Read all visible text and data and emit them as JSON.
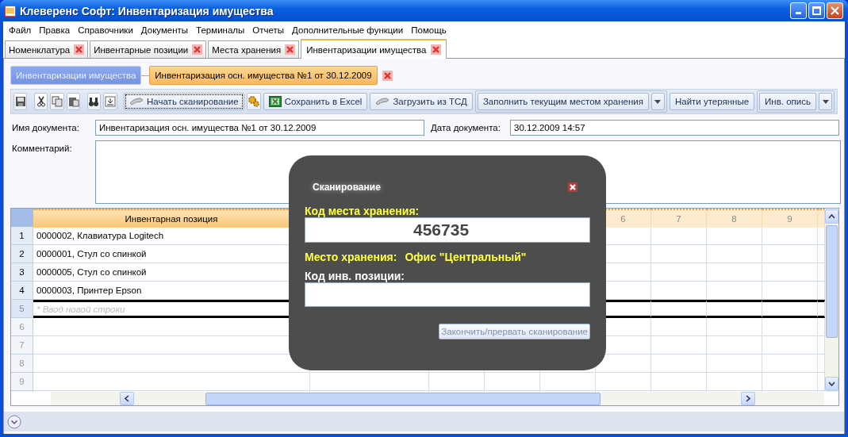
{
  "window": {
    "title": "Клеверенс Софт: Инвентаризация имущества"
  },
  "menu": [
    "Файл",
    "Правка",
    "Справочники",
    "Документы",
    "Терминалы",
    "Отчеты",
    "Дополнительные функции",
    "Помощь"
  ],
  "tabs": [
    {
      "label": "Номенклатура",
      "selected": false
    },
    {
      "label": "Инвентарные позиции",
      "selected": false
    },
    {
      "label": "Места хранения",
      "selected": false
    },
    {
      "label": "Инвентаризации имущества",
      "selected": true
    }
  ],
  "breadcrumb": [
    {
      "label": "Инвентаризации имущества",
      "selected": false
    },
    {
      "label": "Инвентаризация осн. имущества №1 от 30.12.2009",
      "selected": true
    }
  ],
  "toolbar": [
    {
      "kind": "scanner",
      "label": "Начать сканирование",
      "focused": true
    },
    {
      "kind": "gear"
    },
    {
      "kind": "excel",
      "label": "Сохранить в Excel",
      "focused": false
    },
    {
      "kind": "scanner",
      "label": "Загрузить из ТСД",
      "focused": false
    },
    {
      "kind": "split",
      "label": "Заполнить текущим местом хранения",
      "focused": false
    },
    {
      "kind": "plain",
      "label": "Найти утерянные",
      "focused": false
    },
    {
      "kind": "split",
      "label": "Инв. опись",
      "focused": false
    }
  ],
  "form": {
    "name_label": "Имя документа:",
    "name_value": "Инвентаризация осн. имущества №1 от 30.12.2009",
    "date_label": "Дата документа:",
    "date_value": "30.12.2009 14:57",
    "comment_label": "Комментарий:"
  },
  "table": {
    "columns": [
      "Инвентарная позиция",
      "6",
      "7",
      "8",
      "9"
    ],
    "rows": [
      {
        "num": "1",
        "item": "0000002, Клавиатура Logitech"
      },
      {
        "num": "2",
        "item": "0000001, Стул со спинкой"
      },
      {
        "num": "3",
        "item": "0000005, Стул со спинкой"
      },
      {
        "num": "4",
        "item": "0000003, Принтер Epson"
      }
    ],
    "new_row": {
      "num": "5",
      "placeholder": "* Ввод новой строки"
    },
    "empty_rows": [
      "6",
      "7",
      "8",
      "9"
    ]
  },
  "dialog": {
    "title": "Сканирование",
    "location_code_label": "Код места хранения:",
    "location_code_value": "456735",
    "location_label": "Место хранения:",
    "location_value": "Офис \"Центральный\"",
    "item_code_label": "Код инв. позиции:",
    "button": "Закончить/прервать сканирование"
  }
}
